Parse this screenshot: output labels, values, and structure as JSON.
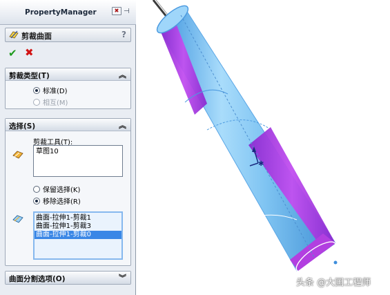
{
  "panel": {
    "header_title": "PropertyManager",
    "feature_title": "剪裁曲面",
    "help": "?",
    "trim_type": {
      "title": "剪裁类型(T)",
      "options": [
        {
          "label": "标准(D)",
          "selected": true,
          "disabled": false
        },
        {
          "label": "相互(M)",
          "selected": false,
          "disabled": true
        }
      ]
    },
    "selection": {
      "title": "选择(S)",
      "trim_tool_label": "剪裁工具(T):",
      "trim_tool_value": "草图10",
      "keep_remove": [
        {
          "label": "保留选择(K)",
          "selected": false
        },
        {
          "label": "移除选择(R)",
          "selected": true
        }
      ],
      "pieces": [
        {
          "label": "曲面-拉伸1-剪裁1",
          "selected": false
        },
        {
          "label": "曲面-拉伸1-剪裁3",
          "selected": false
        },
        {
          "label": "曲面-拉伸1-剪裁0",
          "selected": true
        }
      ]
    },
    "split_options": {
      "title": "曲面分割选项(O)"
    }
  },
  "colors": {
    "surface_blue": "#7fc4f2",
    "surface_magenta": "#b23fe0",
    "ok_green": "#1d9a1d",
    "cancel_red": "#d11414",
    "selection_blue": "#3a87e6"
  },
  "watermark": "头条 @大国工程师"
}
